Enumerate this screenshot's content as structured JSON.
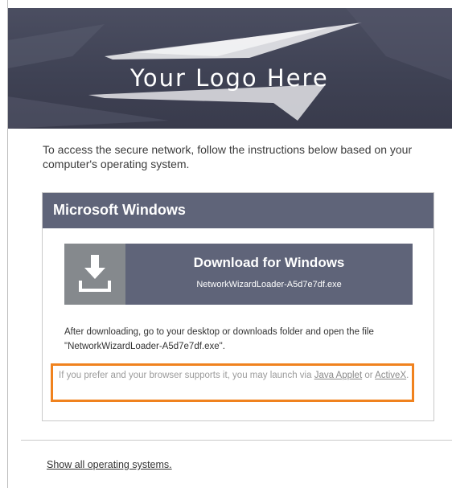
{
  "banner": {
    "logo_text": "Your Logo Here"
  },
  "intro_text": "To access the secure network, follow the instructions below based on your computer's operating system.",
  "panel": {
    "title": "Microsoft Windows",
    "download": {
      "icon": "download-icon",
      "title": "Download for Windows",
      "filename": "NetworkWizardLoader-A5d7e7df.exe"
    },
    "instructions": "After downloading, go to your desktop or downloads folder and open the file \"NetworkWizardLoader-A5d7e7df.exe\".",
    "alt_launch": {
      "prefix": "If you prefer and your browser supports it, you may launch via ",
      "java_link": "Java Applet",
      "middle": " or ",
      "activex_link": "ActiveX",
      "suffix": "."
    }
  },
  "show_all_link": "Show all operating systems.",
  "colors": {
    "banner_bg": "#3f4254",
    "panel_header": "#5f6479",
    "download_button": "#5f6479",
    "icon_box": "#85898d",
    "highlight_border": "#f0821e"
  }
}
